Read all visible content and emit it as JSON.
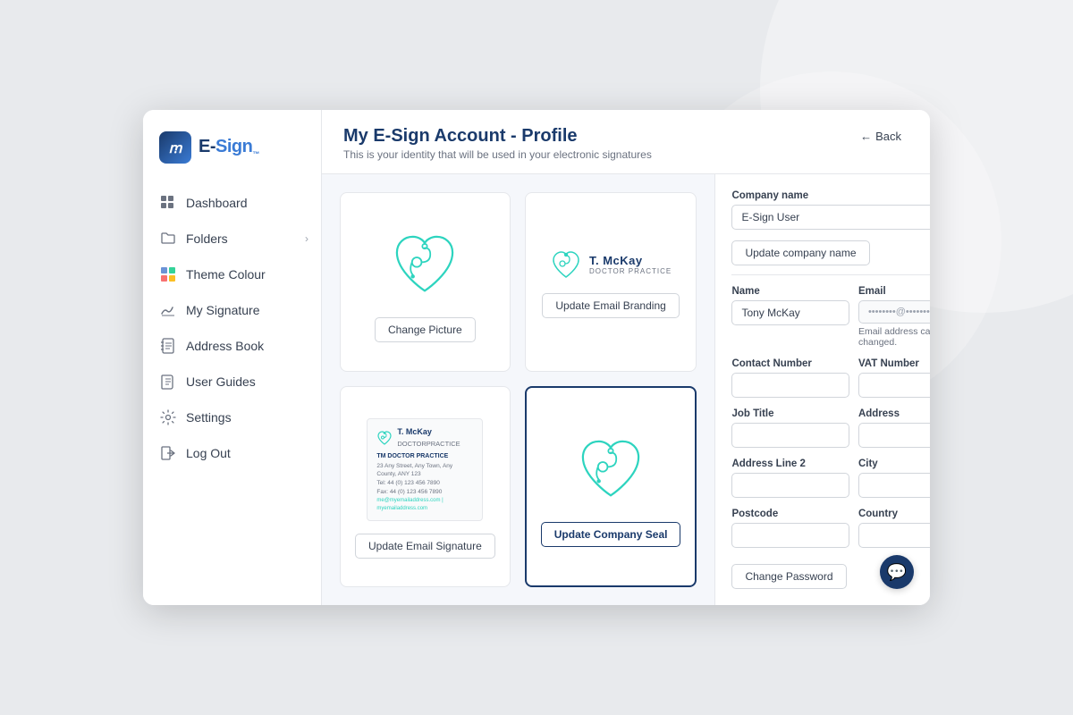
{
  "app": {
    "logo_letter": "ꭑ",
    "logo_text": "E-Sign",
    "window_title": "My E-Sign Account - Profile"
  },
  "sidebar": {
    "items": [
      {
        "id": "dashboard",
        "label": "Dashboard",
        "icon": "grid-icon",
        "has_arrow": false
      },
      {
        "id": "folders",
        "label": "Folders",
        "icon": "folder-icon",
        "has_arrow": true
      },
      {
        "id": "theme-colour",
        "label": "Theme Colour",
        "icon": "theme-icon",
        "has_arrow": false
      },
      {
        "id": "my-signature",
        "label": "My Signature",
        "icon": "signature-icon",
        "has_arrow": false
      },
      {
        "id": "address-book",
        "label": "Address Book",
        "icon": "addressbook-icon",
        "has_arrow": false
      },
      {
        "id": "user-guides",
        "label": "User Guides",
        "icon": "book-icon",
        "has_arrow": false
      },
      {
        "id": "settings",
        "label": "Settings",
        "icon": "settings-icon",
        "has_arrow": false
      },
      {
        "id": "log-out",
        "label": "Log Out",
        "icon": "logout-icon",
        "has_arrow": false
      }
    ]
  },
  "header": {
    "title": "My E-Sign Account - Profile",
    "subtitle": "This is your identity that will be used in your electronic signatures",
    "back_label": "Back"
  },
  "profile_cards": {
    "change_picture_label": "Change Picture",
    "update_email_branding_label": "Update Email Branding",
    "update_email_signature_label": "Update Email Signature",
    "update_company_seal_label": "Update Company Seal",
    "email_branding": {
      "name": "T. McKay",
      "subtitle": "DOCTOR PRACTICE"
    },
    "email_signature": {
      "company": "TM DOCTOR PRACTICE",
      "line1": "23 Any Street, Any Town, Any County, ANY 123",
      "line2": "Tel: 44 (0) 123 456 7890",
      "line3": "Fax: 44 (0) 123 456 7890",
      "line4": "me@myemailaddress.com | myemailaddress.com"
    }
  },
  "form": {
    "company_name_label": "Company name",
    "company_name_value": "E-Sign User",
    "update_company_name_label": "Update company name",
    "name_label": "Name",
    "name_value": "Tony McKay",
    "email_label": "Email",
    "email_value": "••••••••@••••••••",
    "email_note": "Email address can't be changed.",
    "contact_number_label": "Contact Number",
    "contact_number_value": "",
    "vat_number_label": "VAT Number",
    "vat_number_value": "",
    "job_title_label": "Job Title",
    "job_title_value": "",
    "address_label": "Address",
    "address_value": "",
    "address_line2_label": "Address Line 2",
    "address_line2_value": "",
    "city_label": "City",
    "city_value": "",
    "postcode_label": "Postcode",
    "postcode_value": "",
    "country_label": "Country",
    "country_value": "",
    "change_password_label": "Change Password"
  },
  "chat": {
    "icon": "chat-icon"
  }
}
